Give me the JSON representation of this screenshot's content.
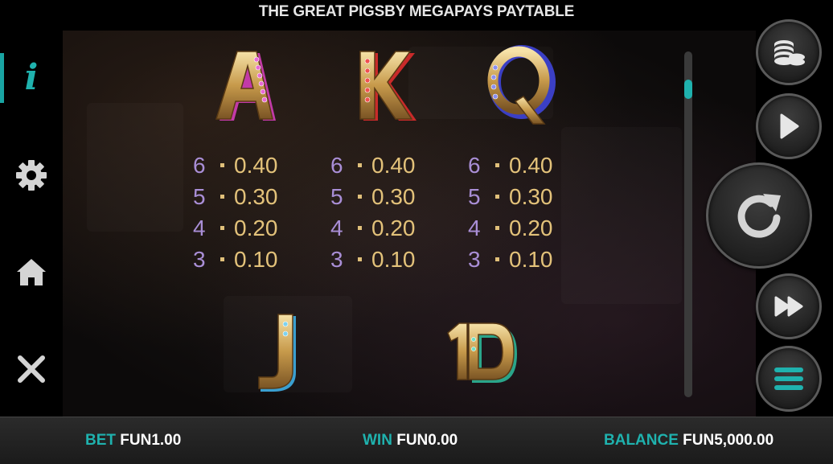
{
  "header": {
    "title": "THE GREAT PIGSBY MEGAPAYS PAYTABLE"
  },
  "sidebar": {
    "items": [
      {
        "name": "info",
        "icon": "info-icon",
        "active": true
      },
      {
        "name": "settings",
        "icon": "gear-icon"
      },
      {
        "name": "home",
        "icon": "home-icon"
      },
      {
        "name": "close",
        "icon": "close-icon"
      }
    ]
  },
  "paytable": {
    "symbols": [
      {
        "symbol": "A",
        "accent": "#c23aa8",
        "pays": [
          {
            "count": "6",
            "value": "0.40"
          },
          {
            "count": "5",
            "value": "0.30"
          },
          {
            "count": "4",
            "value": "0.20"
          },
          {
            "count": "3",
            "value": "0.10"
          }
        ]
      },
      {
        "symbol": "K",
        "accent": "#c92a2a",
        "pays": [
          {
            "count": "6",
            "value": "0.40"
          },
          {
            "count": "5",
            "value": "0.30"
          },
          {
            "count": "4",
            "value": "0.20"
          },
          {
            "count": "3",
            "value": "0.10"
          }
        ]
      },
      {
        "symbol": "Q",
        "accent": "#3b3fc4",
        "pays": [
          {
            "count": "6",
            "value": "0.40"
          },
          {
            "count": "5",
            "value": "0.30"
          },
          {
            "count": "4",
            "value": "0.20"
          },
          {
            "count": "3",
            "value": "0.10"
          }
        ]
      },
      {
        "symbol": "J",
        "accent": "#3a9fd0"
      },
      {
        "symbol": "10",
        "accent": "#2aa58a"
      }
    ]
  },
  "right_controls": {
    "buttons": [
      {
        "name": "bet-coins",
        "icon": "coins-icon"
      },
      {
        "name": "play",
        "icon": "play-icon"
      },
      {
        "name": "spin",
        "icon": "spin-icon"
      },
      {
        "name": "turbo",
        "icon": "fast-forward-icon"
      },
      {
        "name": "menu",
        "icon": "menu-icon"
      }
    ]
  },
  "footer": {
    "bet_label": "BET",
    "bet_value": "FUN1.00",
    "win_label": "WIN",
    "win_value": "FUN0.00",
    "balance_label": "BALANCE",
    "balance_value": "FUN5,000.00"
  },
  "colors": {
    "accent": "#1fb2ae",
    "gold": "#e3c27a",
    "count": "#a98ed6"
  }
}
